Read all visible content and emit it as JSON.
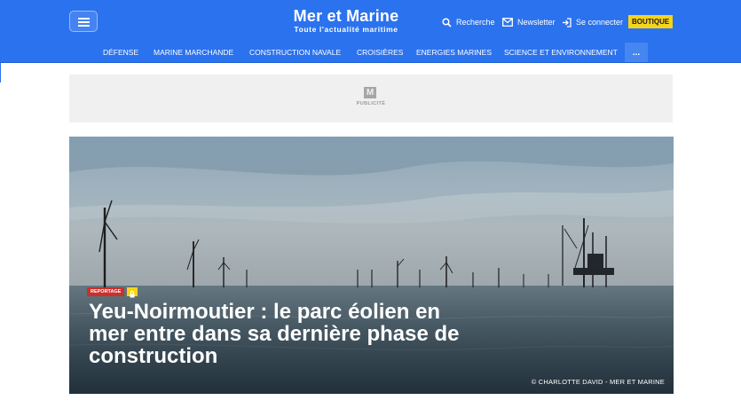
{
  "header": {
    "brand": {
      "name": "Mer et Marine",
      "tagline": "Toute l'actualité maritime"
    },
    "actions": {
      "search": "Recherche",
      "newsletter": "Newsletter",
      "login": "Se connecter",
      "shop": "BOUTIQUE"
    }
  },
  "nav": {
    "items": [
      "DÉFENSE",
      "MARINE MARCHANDE",
      "CONSTRUCTION NAVALE",
      "CROISIÈRES",
      "ENERGIES MARINES",
      "SCIENCE ET ENVIRONNEMENT"
    ],
    "more": "..."
  },
  "ad": {
    "logo_letter": "M",
    "label": "PUBLICITÉ"
  },
  "hero": {
    "category": "REPORTAGE",
    "title": "Yeu-Noirmoutier : le parc éolien en mer entre dans sa dernière phase de construction",
    "credit": "© CHARLOTTE DAVID - MER ET MARINE"
  },
  "icons": {
    "menu": "hamburger-icon",
    "search": "search-icon",
    "newsletter": "mail-icon",
    "login": "login-icon",
    "premium": "lock-icon"
  },
  "colors": {
    "primary": "#2b72ee",
    "accent": "#f6d41a",
    "badge": "#c9302c"
  }
}
